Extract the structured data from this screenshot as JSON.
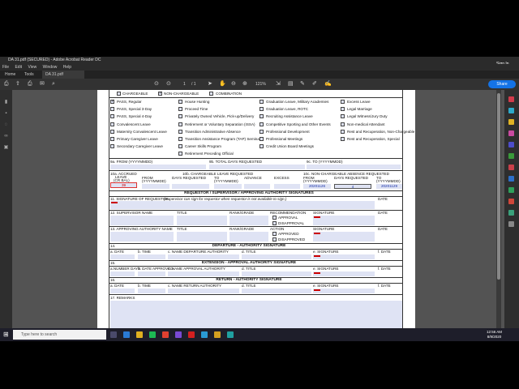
{
  "window": {
    "title": "DA 31.pdf (SECURED) - Adobe Acrobat Reader DC",
    "menus": [
      "File",
      "Edit",
      "View",
      "Window",
      "Help"
    ],
    "tabs": [
      "Home",
      "Tools",
      "DA 31.pdf (SECURE..."
    ],
    "sign_in": "Sign In",
    "share": "Share",
    "page": "1",
    "page_total": "/ 1",
    "zoom": "121%"
  },
  "form": {
    "leave_type": {
      "chargeable": "CHARGEABLE",
      "non_chargeable": "NON-CHARGEABLE",
      "combination": "COMBINATION"
    },
    "options_col1": [
      "PASS, Regular",
      "PASS, Special 3-Day",
      "PASS, Special 4-Day",
      "Convalescent Leave",
      "Maternity Convalescent Leave",
      "Primary Caregiver Leave",
      "Secondary Caregiver Leave"
    ],
    "options_col2": [
      "House Hunting",
      "Proceed Time",
      "Privately Owned Vehicle, Pick-up/Delivery",
      "Retirement or Voluntary Separation (ISSA)",
      "Transition Administrative Absence",
      "Transition Assistance Program (TAP) Seminar",
      "Career Skills Program",
      "Retirement Preceding Official"
    ],
    "options_col3": [
      "Graduation Leave, Military Academies",
      "Graduation Leave, ROTC",
      "Recruiting Assistance Leave",
      "Competitive Sporting and Other Events",
      "Professional Development",
      "Professional Meetings",
      "Credit Union Board Meetings"
    ],
    "options_col4": [
      "Excess Leave",
      "Legal Marriage",
      "Legal Witness/Jury Duty",
      "Non-medical Attendant",
      "Rest and Recuperation, Non-Chargeable",
      "Rest and Recuperation, Special"
    ],
    "f9a": "9a. FROM (YYYYMMDD)",
    "f9b": "9b. TOTAL DAYS REQUESTED",
    "f9c": "9c. TO (YYYYMMDD)",
    "f10a_l1": "10a. ACCRUED",
    "f10a_l2": "LEAVE",
    "f10a_l3": "(CR BAL)",
    "f10a_val": "39",
    "f10b": "10b. CHARGEABLE LEAVE REQUESTED",
    "f10c": "10c. NON-CHARGEABLE ABSENCE REQUESTED",
    "from": "FROM",
    "yyyymmdd": "(YYYYMMDD)",
    "days_req": "DAYS REQUESTED",
    "to": "TO",
    "advance": "ADVANCE",
    "excess": "EXCESS",
    "nc_from": "20201126",
    "nc_days": "4",
    "nc_to": "20201129",
    "sec_sig": "REQUESTOR / SUPERVISOR / APPROVING AUTHORITY SIGNATURES",
    "f11": "11. SIGNATURE OF REQUESTOR",
    "f11_note": "(Supervisor can sign for requestor when requestor is not available to sign.)",
    "date": "DATE",
    "f12": "12. SUPERVISOR NAME",
    "title": "TITLE",
    "rank": "RANK/GRADE",
    "recommendation": "RECOMMENDATION",
    "approval": "APPROVAL",
    "disapproval": "DISAPPROVAL",
    "signature": "SIGNATURE",
    "f13": "13. APPROVING AUTHORITY NAME",
    "action": "ACTION",
    "approved": "APPROVED",
    "disapproved": "DISAPPROVED",
    "f14": "14.",
    "sec_dep": "DEPARTURE - AUTHORITY SIGNATURE",
    "a_date": "a. DATE",
    "b_time": "b. TIME",
    "c_dep": "c. NAME DEPARTURE AUTHORITY",
    "d_title": "d. TITLE",
    "e_sig": "e. SIGNATURE",
    "f_date": "f. DATE",
    "f15": "15.",
    "sec_ext": "EXTENSION - APPROVAL AUTHORITY SIGNATURE",
    "a_days": "a.NUMBER DAYS",
    "b_dateapp": "b. DATE APPROVED",
    "c_ext": "c. NAME APPROVAL AUTHORITY",
    "f16": "16.",
    "sec_ret": "RETURN - AUTHORITY SIGNATURE",
    "c_ret": "c. NAME RETURN AUTHORITY",
    "f17": "17. REMARKS"
  },
  "taskbar": {
    "search": "Type here to search",
    "time": "12:56 AM",
    "date": "8/9/2020"
  }
}
